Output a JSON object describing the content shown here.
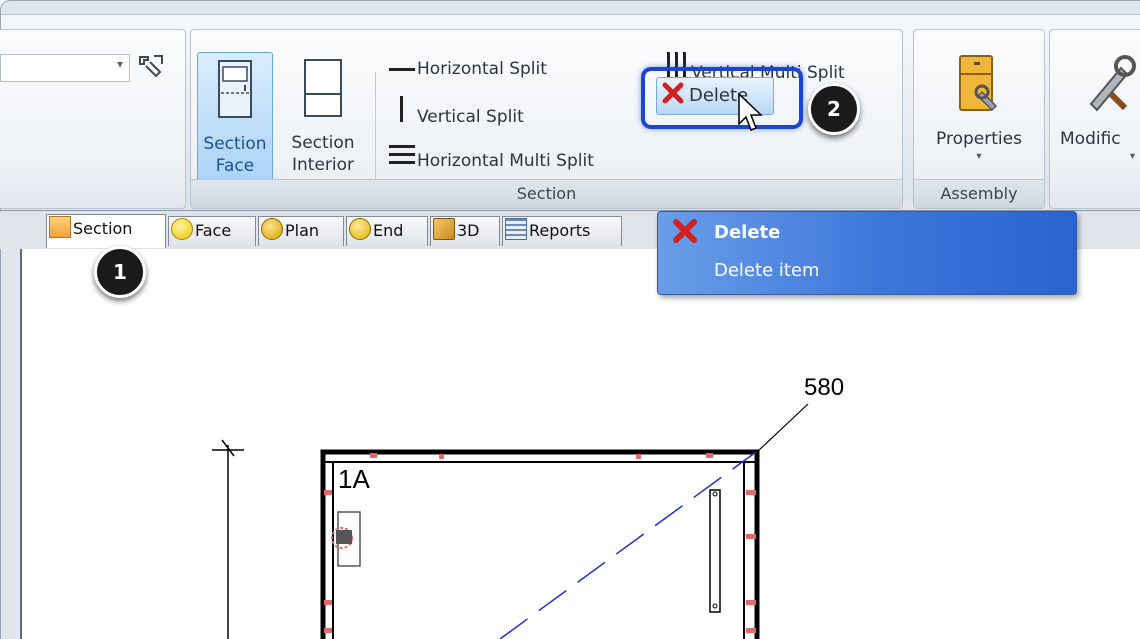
{
  "ribbon": {
    "section_group": {
      "caption": "Section",
      "section_face_label_1": "Section",
      "section_face_label_2": "Face",
      "section_interior_label_1": "Section",
      "section_interior_label_2": "Interior",
      "horizontal_split": "Horizontal Split",
      "vertical_split": "Vertical Split",
      "horizontal_multi_split": "Horizontal Multi Split",
      "vertical_multi_split": "Vertical Multi Split",
      "delete": "Delete"
    },
    "assembly_group": {
      "caption": "Assembly",
      "properties": "Properties"
    },
    "modifiers_label": "Modific"
  },
  "tabs": [
    {
      "label": "Section",
      "icon": "section-icon",
      "active": true
    },
    {
      "label": "Face",
      "icon": "face-icon"
    },
    {
      "label": "Plan",
      "icon": "plan-icon"
    },
    {
      "label": "End",
      "icon": "end-icon"
    },
    {
      "label": "3D",
      "icon": "3d-box-icon"
    },
    {
      "label": "Reports",
      "icon": "reports-icon"
    }
  ],
  "tooltip": {
    "title": "Delete",
    "description": "Delete item"
  },
  "callouts": {
    "step1": "1",
    "step2": "2"
  },
  "drawing": {
    "dimension": "580",
    "section_label": "1A"
  },
  "colors": {
    "accent_blue": "#1a44d6",
    "tooltip_blue": "#3b75d9",
    "delete_red": "#d32020",
    "dash_line": "#1f2fd0"
  }
}
